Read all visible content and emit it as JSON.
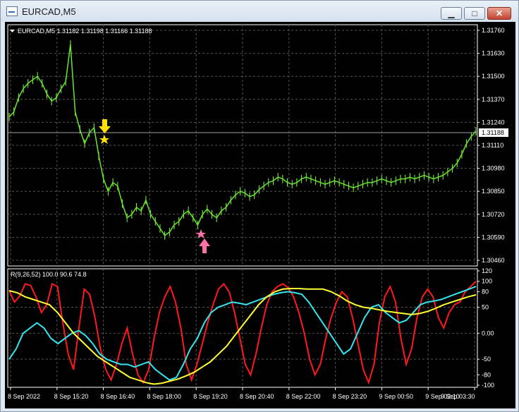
{
  "window": {
    "title": "EURCAD,M5"
  },
  "controls": {
    "minimize": "▁",
    "maximize": "□",
    "close": "✕"
  },
  "chart": {
    "symbol_header": "EURCAD,M5  1.31182 1.31198 1.31166 1.31188",
    "price_ticks": [
      "1.31760",
      "1.31630",
      "1.31500",
      "1.31370",
      "1.31240",
      "1.31110",
      "1.30980",
      "1.30850",
      "1.30720",
      "1.30590",
      "1.30460"
    ],
    "current_price": "1.31188",
    "indicator_header": "R(9,26,52) 100.0 90.6 74.8",
    "indicator_ticks": [
      "120",
      "100",
      "80",
      "50",
      "0.00",
      "-50",
      "-80",
      "-100"
    ],
    "time_ticks": [
      "8 Sep 2022",
      "8 Sep 15:20",
      "8 Sep 16:40",
      "8 Sep 18:00",
      "8 Sep 19:20",
      "8 Sep 20:40",
      "8 Sep 22:00",
      "8 Sep 23:20",
      "9 Sep 00:50",
      "9 Sep 02:10",
      "9 Sep 03:30"
    ]
  },
  "chart_data": {
    "type": "line",
    "series": [
      {
        "values": [
          1.3127,
          1.313,
          1.3138,
          1.3143,
          1.3146,
          1.3148,
          1.315,
          1.3146,
          1.314,
          1.3136,
          1.3138,
          1.3143,
          1.3147,
          1.3168,
          1.313,
          1.312,
          1.3112,
          1.3118,
          1.3121,
          1.3105,
          1.3092,
          1.3085,
          1.309,
          1.3088,
          1.3078,
          1.307,
          1.3072,
          1.3076,
          1.3074,
          1.308,
          1.3072,
          1.3068,
          1.3064,
          1.306,
          1.3062,
          1.3066,
          1.3068,
          1.3072,
          1.3074,
          1.307,
          1.3066,
          1.3072,
          1.3075,
          1.3072,
          1.307,
          1.3074,
          1.3076,
          1.308,
          1.3083,
          1.3085,
          1.3084,
          1.3082,
          1.3083,
          1.3086,
          1.3088,
          1.309,
          1.3091,
          1.3093,
          1.3092,
          1.309,
          1.3089,
          1.309,
          1.3092,
          1.3093,
          1.3092,
          1.3091,
          1.309,
          1.3089,
          1.309,
          1.3091,
          1.309,
          1.3089,
          1.3088,
          1.3087,
          1.3088,
          1.3089,
          1.309,
          1.309,
          1.3091,
          1.3092,
          1.3091,
          1.309,
          1.3091,
          1.3092,
          1.3092,
          1.3093,
          1.3092,
          1.3093,
          1.3094,
          1.3093,
          1.3092,
          1.3093,
          1.3094,
          1.3096,
          1.3098,
          1.3101,
          1.3106,
          1.3112,
          1.3116,
          1.3119
        ]
      },
      {
        "values": [
          82,
          60,
          72,
          95,
          92,
          70,
          40,
          55,
          95,
          90,
          20,
          -40,
          -70,
          10,
          85,
          75,
          30,
          -30,
          -70,
          -90,
          -60,
          -20,
          10,
          -40,
          -80,
          -95,
          -70,
          -10,
          40,
          70,
          90,
          60,
          10,
          -60,
          -90,
          -60,
          -20,
          20,
          55,
          85,
          95,
          80,
          40,
          -10,
          -60,
          -80,
          -40,
          10,
          55,
          80,
          90,
          95,
          88,
          70,
          40,
          0,
          -50,
          -80,
          -60,
          -10,
          30,
          60,
          80,
          70,
          30,
          -20,
          -70,
          -95,
          -60,
          20,
          70,
          90,
          60,
          -10,
          -60,
          -30,
          30,
          70,
          85,
          70,
          30,
          10,
          40,
          55,
          60,
          80,
          90,
          100
        ]
      },
      {
        "values": [
          -50,
          -30,
          0,
          10,
          20,
          10,
          -10,
          -20,
          -10,
          0,
          5,
          -5,
          -20,
          -40,
          -50,
          -55,
          -60,
          -60,
          -65,
          -60,
          -55,
          -70,
          -80,
          -90,
          -85,
          -60,
          -30,
          -10,
          20,
          40,
          50,
          55,
          60,
          58,
          55,
          60,
          65,
          70,
          75,
          78,
          80,
          78,
          75,
          60,
          40,
          20,
          0,
          -20,
          -40,
          -30,
          0,
          30,
          50,
          55,
          40,
          30,
          20,
          25,
          40,
          55,
          60,
          62,
          65,
          70,
          75,
          80,
          85,
          90
        ]
      },
      {
        "values": [
          82,
          78,
          70,
          65,
          60,
          55,
          40,
          20,
          0,
          -15,
          -30,
          -45,
          -55,
          -65,
          -75,
          -85,
          -90,
          -95,
          -98,
          -96,
          -92,
          -88,
          -82,
          -75,
          -65,
          -55,
          -40,
          -25,
          -5,
          15,
          35,
          55,
          70,
          80,
          85,
          86,
          86,
          85,
          85,
          85,
          80,
          72,
          62,
          55,
          50,
          48,
          45,
          42,
          40,
          38,
          36,
          38,
          42,
          48,
          55,
          60,
          65,
          70,
          74
        ]
      }
    ]
  }
}
